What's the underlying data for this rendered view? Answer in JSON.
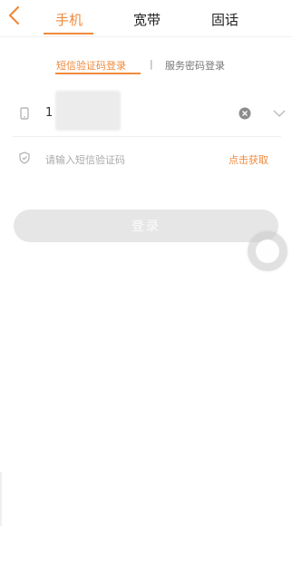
{
  "header": {
    "back_icon": "chevron-left-icon",
    "tabs": [
      {
        "label": "手机",
        "active": true
      },
      {
        "label": "宽带",
        "active": false
      },
      {
        "label": "固话",
        "active": false
      }
    ],
    "accent_color": "#f08a3c"
  },
  "login_mode": {
    "sms_label": "短信验证码登录",
    "password_label": "服务密码登录",
    "separator": "|"
  },
  "form": {
    "phone_value": "1",
    "code_placeholder": "请输入短信验证码",
    "get_code_label": "点击获取"
  },
  "login_button_label": "登录"
}
